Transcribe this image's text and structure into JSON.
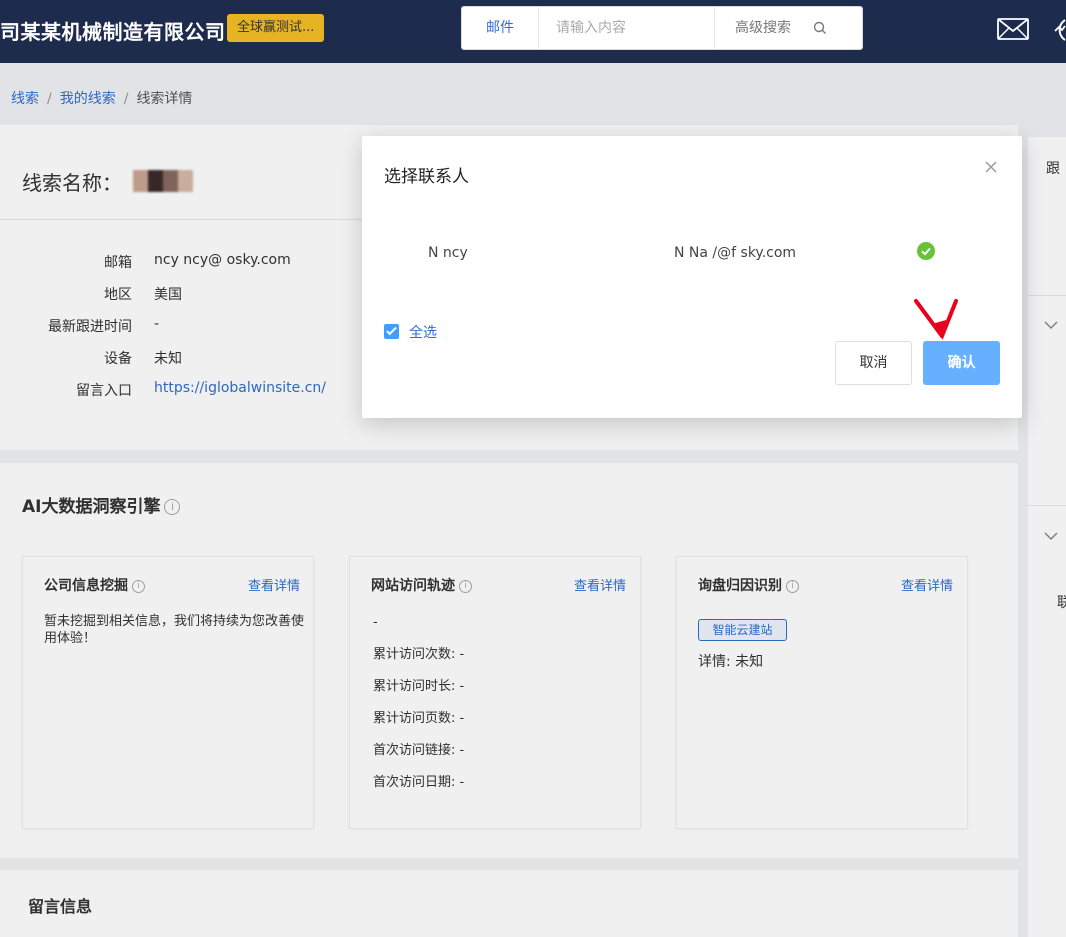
{
  "header": {
    "company": "司某某机械制造有限公司",
    "tag": "全球赢测试...",
    "search": {
      "type_label": "邮件",
      "placeholder": "请输入内容",
      "advanced_label": "高级搜索"
    },
    "icons": [
      "mail-icon",
      "chat-icon",
      "search-icon"
    ]
  },
  "breadcrumb": {
    "items": [
      "线索",
      "我的线索",
      "线索详情"
    ],
    "separator": "/"
  },
  "lead": {
    "name_label": "线索名称：",
    "fields": [
      {
        "label": "邮箱",
        "value": "ncy   ncy@    osky.com"
      },
      {
        "label": "地区",
        "value": "美国"
      },
      {
        "label": "最新跟进时间",
        "value": "-"
      },
      {
        "label": "设备",
        "value": "未知"
      },
      {
        "label": "留言入口",
        "value": "https://iglobalwinsite.cn/"
      }
    ]
  },
  "right_panel": {
    "top_text": "跟",
    "bottom_text": "联"
  },
  "ai": {
    "title": "AI大数据洞察引擎",
    "info_glyph": "i",
    "cards": [
      {
        "title": "公司信息挖掘",
        "link": "查看详情",
        "text": "暂未挖掘到相关信息，我们将持续为您改善使用体验！"
      },
      {
        "title": "网站访问轨迹",
        "link": "查看详情",
        "stats": [
          "-",
          "累计访问次数: -",
          "累计访问时长: -",
          "累计访问页数: -",
          "首次访问链接: -",
          "首次访问日期: -"
        ]
      },
      {
        "title": "询盘归因识别",
        "link": "查看详情",
        "badge": "智能云建站",
        "detail": "详情: 未知"
      }
    ]
  },
  "message": {
    "title": "留言信息"
  },
  "dialog": {
    "title": "选择联系人",
    "contact": {
      "name": "N   ncy",
      "email": "N     Na    /@f    sky.com"
    },
    "select_all": "全选",
    "cancel": "取消",
    "confirm": "确认",
    "colors": {
      "primary": "#2f6fd0",
      "confirm_button": "#66b1ff",
      "checked": "#67c23a",
      "arrow": "#e8001c"
    }
  }
}
